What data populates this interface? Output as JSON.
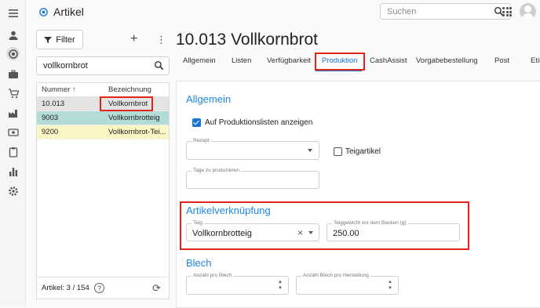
{
  "app": {
    "title": "Artikel"
  },
  "search": {
    "placeholder": "Suchen"
  },
  "left": {
    "filter_label": "Filter",
    "search_value": "vollkornbrot",
    "columns": {
      "nummer": "Nummer",
      "sort": "↑",
      "bezeichnung": "Bezeichnung"
    },
    "rows": [
      {
        "nummer": "10.013",
        "bezeichnung": "Vollkornbrot"
      },
      {
        "nummer": "9003",
        "bezeichnung": "Vollkornbrotteig"
      },
      {
        "nummer": "9200",
        "bezeichnung": "Vollkornbrot-Tei..."
      }
    ],
    "footer": "Artikel: 3 / 154",
    "help_glyph": "?"
  },
  "main": {
    "title": "10.013 Vollkornbrot",
    "tabs": [
      "Allgemein",
      "Listen",
      "Verfügbarkeit",
      "Produktion",
      "CashAssist",
      "Vorgabebestellung",
      "Post",
      "Etik"
    ],
    "active_tab": "Produktion",
    "sections": {
      "allgemein": "Allgemein",
      "artikelverknuepfung": "Artikelverknüpfung",
      "blech": "Blech"
    },
    "fields": {
      "produktionslisten": "Auf Produktionslisten anzeigen",
      "rezept": "Rezept",
      "teigartikel": "Teigartikel",
      "tage": "Tage zu produzieren",
      "teig_label": "Teig",
      "teig_value": "Vollkornbrotteig",
      "teiggewicht_label": "Teiggewicht vor dem Backen (g)",
      "teiggewicht_value": "250.00",
      "anzahl_blech": "Anzahl pro Blech",
      "anzahl_herstellung": "Anzahl Blech pro Herstellung"
    }
  },
  "colors": {
    "accent": "#1976d2",
    "highlight_red": "#e0261b",
    "teal_row": "#b4dcd6",
    "yellow_row": "#fbf6c4"
  }
}
